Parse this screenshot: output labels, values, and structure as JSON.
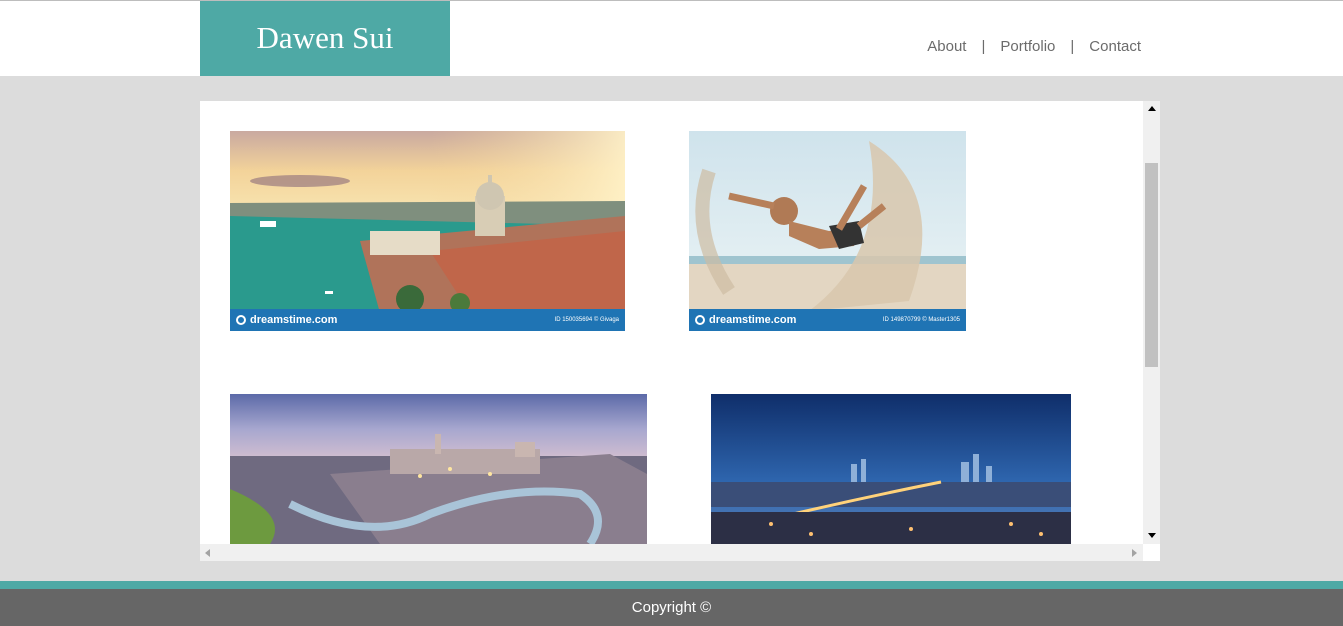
{
  "header": {
    "logo_text": "Dawen Sui",
    "nav": [
      {
        "label": "About"
      },
      {
        "label": "Portfolio"
      },
      {
        "label": "Contact"
      }
    ],
    "separator": "|"
  },
  "gallery": {
    "photos": [
      {
        "watermark": "dreamstime.com",
        "id_text": "ID 150035694 © Givaga"
      },
      {
        "watermark": "dreamstime.com",
        "id_text": "ID 149870799 © Master1305"
      },
      {
        "watermark": "",
        "id_text": ""
      },
      {
        "watermark": "",
        "id_text": ""
      }
    ]
  },
  "footer": {
    "copyright": "Copyright ©"
  },
  "colors": {
    "accent": "#4ea9a5",
    "background": "#dcdcdc",
    "footer": "#666666"
  }
}
